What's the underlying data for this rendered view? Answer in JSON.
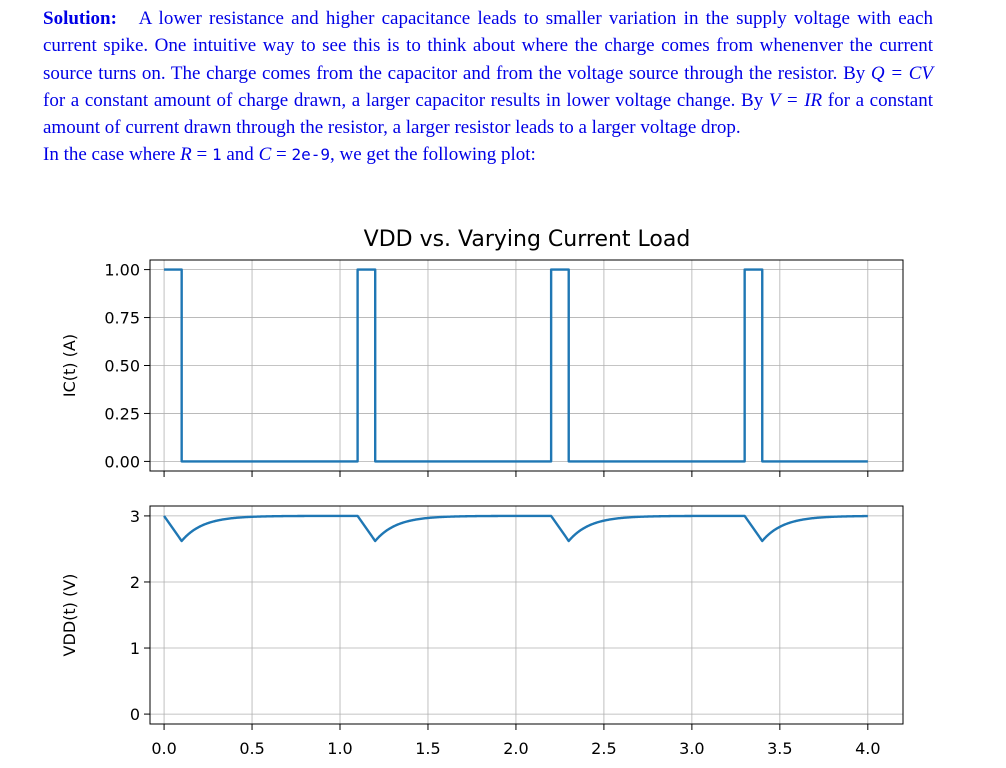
{
  "paragraph": {
    "label": "Solution:",
    "body_pre_q": "A lower resistance and higher capacitance leads to smaller variation in the supply voltage with each current spike. One intuitive way to see this is to think about where the charge comes from whenenver the current source turns on. The charge comes from the capacitor and from the voltage source through the resistor. By ",
    "eq_q": "Q = CV",
    "body_mid": " for a constant amount of charge drawn, a larger capacitor results in lower voltage change. By ",
    "eq_v": "V = IR",
    "body_post": " for a constant amount of current drawn through the resistor, a larger resistor leads to a larger voltage drop."
  },
  "case_line": {
    "pre": "In the case where ",
    "r_sym": "R",
    "eq1": " = ",
    "r_val": "1",
    "and": " and ",
    "c_sym": "C",
    "eq2": " = ",
    "c_val": "2e-9",
    "post": ", we get the following plot:"
  },
  "chart_data": [
    {
      "type": "line",
      "title": "VDD vs. Varying Current Load",
      "xlabel": "",
      "ylabel": "IC(t) (A)",
      "xlim": [
        -0.08,
        4.2
      ],
      "ylim": [
        -0.05,
        1.05
      ],
      "yticks": [
        0.0,
        0.25,
        0.5,
        0.75,
        1.0
      ],
      "ytick_labels": [
        "0.00",
        "0.25",
        "0.50",
        "0.75",
        "1.00"
      ],
      "grid": true,
      "color": "#1f77b4",
      "series": [
        {
          "x": [
            0,
            0.1,
            0.1,
            1.1,
            1.1,
            1.2,
            1.2,
            2.2,
            2.2,
            2.3,
            2.3,
            3.3,
            3.3,
            3.4,
            3.4,
            4.0
          ],
          "y": [
            1,
            1,
            0,
            0,
            1,
            1,
            0,
            0,
            1,
            1,
            0,
            0,
            1,
            1,
            0,
            0
          ]
        }
      ]
    },
    {
      "type": "line",
      "xlabel": "",
      "ylabel": "VDD(t) (V)",
      "xlim": [
        -0.08,
        4.2
      ],
      "ylim": [
        -0.15,
        3.15
      ],
      "yticks": [
        0,
        1,
        2,
        3
      ],
      "ytick_labels": [
        "0",
        "1",
        "2",
        "3"
      ],
      "xticks": [
        0.0,
        0.5,
        1.0,
        1.5,
        2.0,
        2.5,
        3.0,
        3.5,
        4.0
      ],
      "xtick_labels": [
        "0.0",
        "0.5",
        "1.0",
        "1.5",
        "2.0",
        "2.5",
        "3.0",
        "3.5",
        "4.0"
      ],
      "grid": true,
      "color": "#1f77b4",
      "model": {
        "v_supply": 3.0,
        "v_min": 2.62,
        "pulse_starts": [
          0,
          1.1,
          2.2,
          3.3
        ],
        "pulse_width": 0.1,
        "recovery_tau": 0.12,
        "x_end": 4.0
      }
    }
  ]
}
